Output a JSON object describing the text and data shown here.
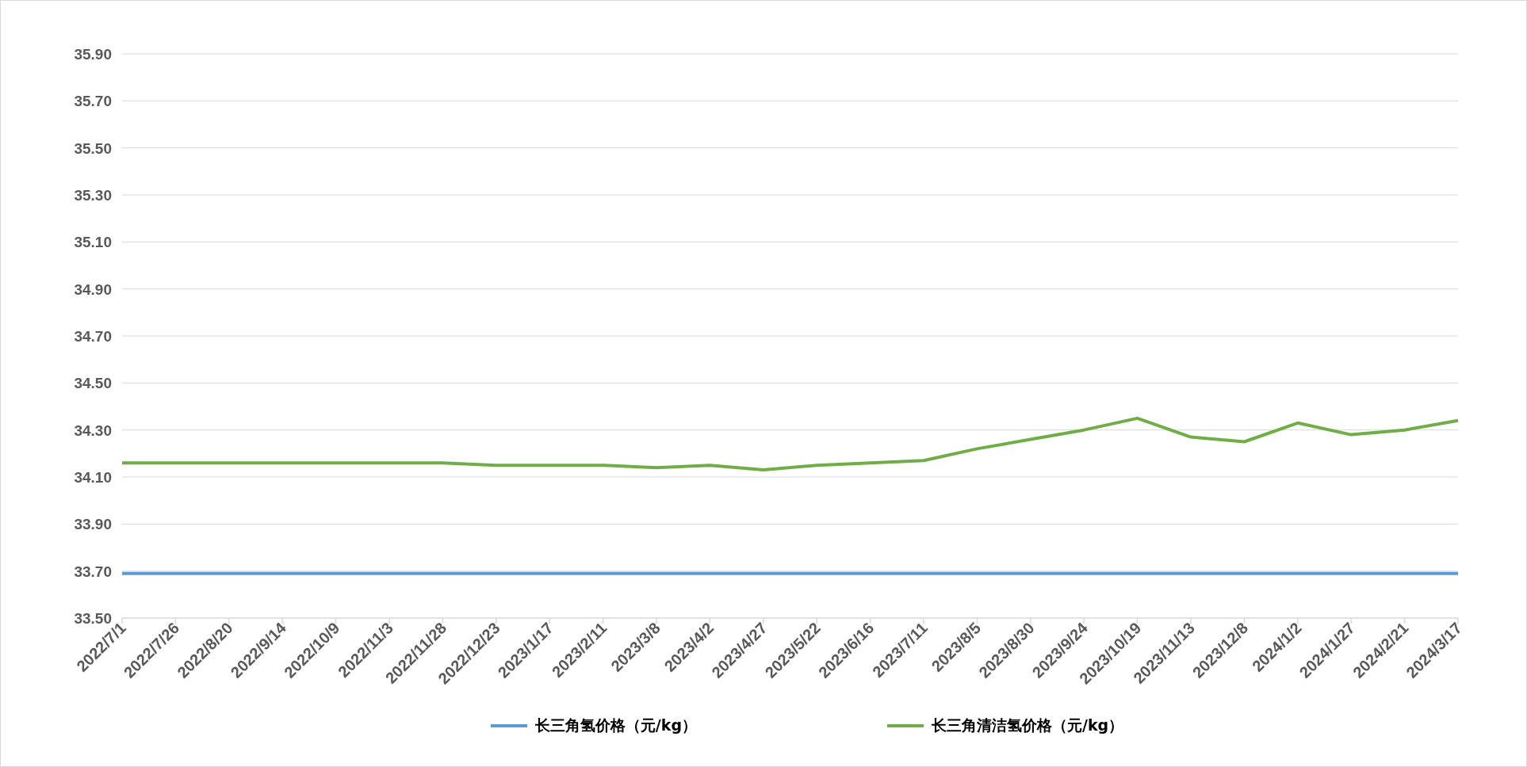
{
  "chart_data": {
    "type": "line",
    "grid": true,
    "categories": [
      "2022/7/1",
      "2022/7/26",
      "2022/8/20",
      "2022/9/14",
      "2022/10/9",
      "2022/11/3",
      "2022/11/28",
      "2022/12/23",
      "2023/1/17",
      "2023/2/11",
      "2023/3/8",
      "2023/4/2",
      "2023/4/27",
      "2023/5/22",
      "2023/6/16",
      "2023/7/11",
      "2023/8/5",
      "2023/8/30",
      "2023/9/24",
      "2023/10/19",
      "2023/11/13",
      "2023/12/8",
      "2024/1/2",
      "2024/1/27",
      "2024/2/21",
      "2024/3/17"
    ],
    "series": [
      {
        "name": "长三角氢价格（元/kg）",
        "color": "#5b9bd5",
        "values": [
          33.69,
          33.69,
          33.69,
          33.69,
          33.69,
          33.69,
          33.69,
          33.69,
          33.69,
          33.69,
          33.69,
          33.69,
          33.69,
          33.69,
          33.69,
          33.69,
          33.69,
          33.69,
          33.69,
          33.69,
          33.69,
          33.69,
          33.69,
          33.69,
          33.69,
          33.69
        ]
      },
      {
        "name": "长三角清洁氢价格（元/kg）",
        "color": "#70ad47",
        "values": [
          34.16,
          34.16,
          34.16,
          34.16,
          34.16,
          34.16,
          34.16,
          34.15,
          34.15,
          34.15,
          34.14,
          34.15,
          34.13,
          34.15,
          34.16,
          34.17,
          34.22,
          34.26,
          34.3,
          34.35,
          34.27,
          34.25,
          34.33,
          34.28,
          34.3,
          34.34
        ]
      }
    ],
    "ylim": [
      33.5,
      35.9
    ],
    "yticks": [
      {
        "value": 33.5,
        "label": "33.50"
      },
      {
        "value": 33.7,
        "label": "33.70"
      },
      {
        "value": 33.9,
        "label": "33.90"
      },
      {
        "value": 34.1,
        "label": "34.10"
      },
      {
        "value": 34.3,
        "label": "34.30"
      },
      {
        "value": 34.5,
        "label": "34.50"
      },
      {
        "value": 34.7,
        "label": "34.70"
      },
      {
        "value": 34.9,
        "label": "34.90"
      },
      {
        "value": 35.1,
        "label": "35.10"
      },
      {
        "value": 35.3,
        "label": "35.30"
      },
      {
        "value": 35.5,
        "label": "35.50"
      },
      {
        "value": 35.7,
        "label": "35.70"
      },
      {
        "value": 35.9,
        "label": "35.90"
      }
    ]
  }
}
